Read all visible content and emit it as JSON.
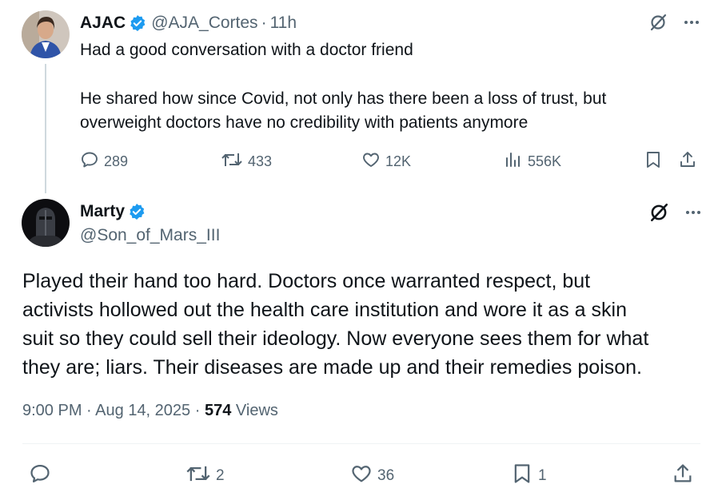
{
  "quoted_tweet": {
    "display_name": "AJAC",
    "handle": "@AJA_Cortes",
    "separator": "·",
    "time_ago": "11h",
    "text_line1": "Had a good conversation with a doctor friend",
    "text_para2_line1": "He shared how since Covid, not only has there been a loss of trust, but",
    "text_para2_line2": "overweight doctors have no credibility with patients anymore",
    "replies": "289",
    "reposts": "433",
    "likes": "12K",
    "views": "556K"
  },
  "main_tweet": {
    "display_name": "Marty",
    "handle": "@Son_of_Mars_III",
    "text_lines": [
      "Played their hand too hard. Doctors once warranted respect, but",
      "activists hollowed out the health care institution and wore it as a skin",
      "suit so they could sell their ideology. Now everyone sees them for what",
      "they are; liars. Their diseases are made up and their remedies poison."
    ],
    "time": "9:00 PM",
    "separator": "·",
    "date": "Aug 14, 2025",
    "views_count": "574",
    "views_label": "Views",
    "replies": "",
    "reposts": "2",
    "likes": "36",
    "bookmarks": "1"
  },
  "icons": {
    "verified": "verified-badge-icon",
    "grok": "grok-icon",
    "more": "more-icon",
    "reply": "reply-icon",
    "repost": "repost-icon",
    "like": "heart-icon",
    "views": "bar-chart-icon",
    "bookmark": "bookmark-icon",
    "share": "share-icon"
  },
  "colors": {
    "text": "#0f1419",
    "secondary": "#536471",
    "verified": "#1d9bf0",
    "thread_line": "#cfd9de"
  }
}
